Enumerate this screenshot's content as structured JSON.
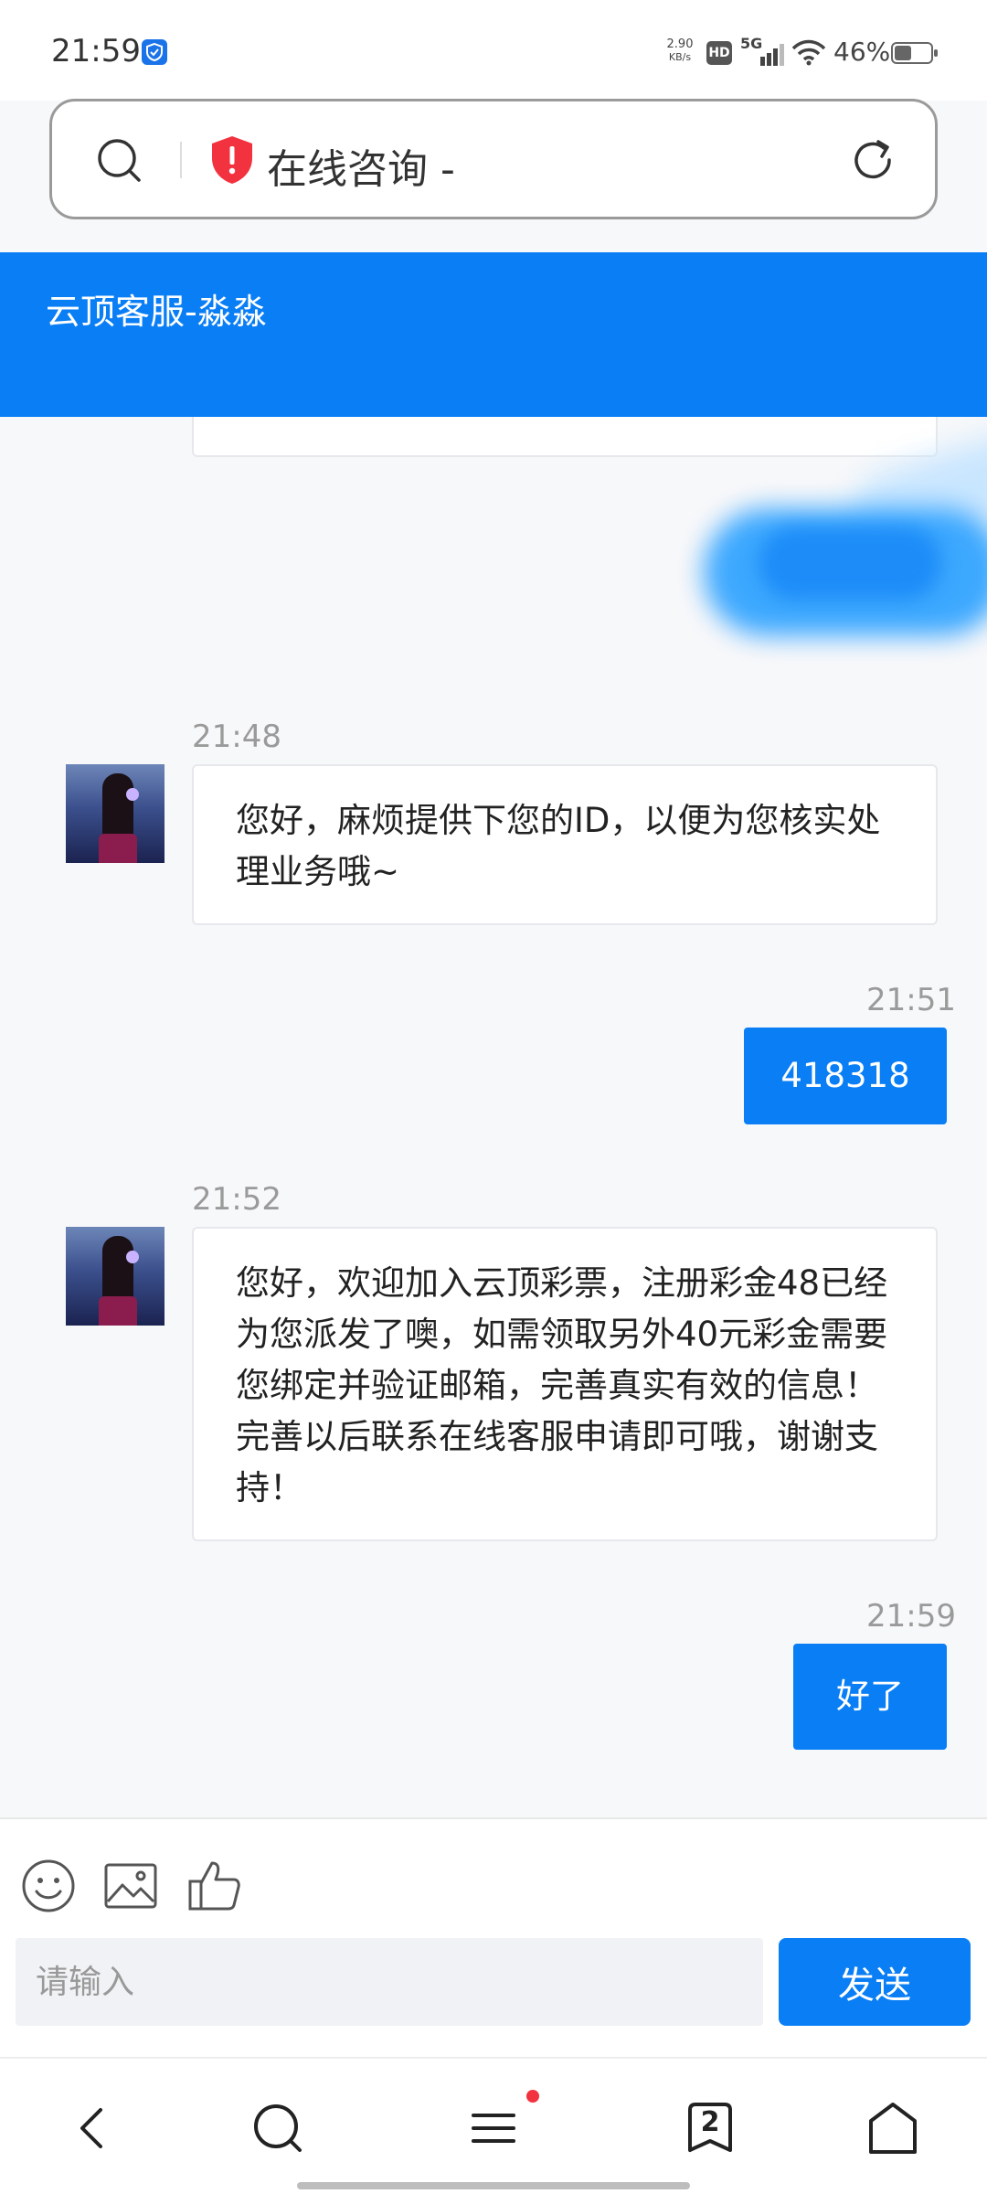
{
  "status_bar": {
    "time": "21:59",
    "net_speed_value": "2.90",
    "net_speed_unit": "KB/s",
    "hd": "HD",
    "network": "5G",
    "battery": "46%"
  },
  "browser": {
    "page_title": "在线咨询 -"
  },
  "chat": {
    "header_title": "云顶客服-淼淼",
    "messages": [
      {
        "time": "21:48",
        "text": "您好，麻烦提供下您的ID，以便为您核实处理业务哦~"
      },
      {
        "time": "21:51",
        "text": "418318"
      },
      {
        "time": "21:52",
        "text": "您好，欢迎加入云顶彩票，注册彩金48已经为您派发了噢，如需领取另外40元彩金需要您绑定并验证邮箱，完善真实有效的信息！完善以后联系在线客服申请即可哦，谢谢支持！"
      },
      {
        "time": "21:59",
        "text": "好了"
      }
    ]
  },
  "composer": {
    "placeholder": "请输入",
    "send_label": "发送"
  },
  "nav": {
    "tab_count": "2"
  },
  "colors": {
    "accent": "#0a7ef5",
    "badge_red": "#f2323e"
  }
}
